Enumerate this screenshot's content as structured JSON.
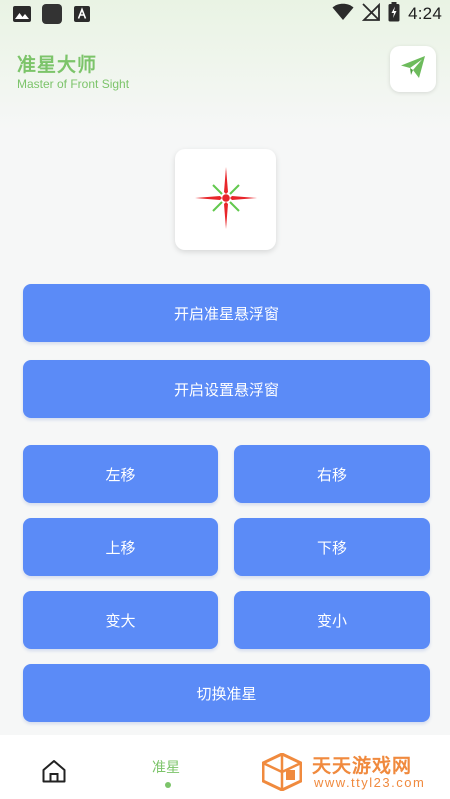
{
  "status_bar": {
    "time": "4:24",
    "left_icons": [
      "image-icon",
      "app-square-icon",
      "text-a-icon"
    ],
    "right_icons": [
      "wifi-icon",
      "signal-off-icon",
      "battery-charging-icon"
    ]
  },
  "header": {
    "title": "准星大师",
    "subtitle": "Master of Front Sight",
    "share_icon": "send-icon"
  },
  "preview": {
    "icon": "crosshair-icon"
  },
  "buttons": {
    "open_crosshair_window": "开启准星悬浮窗",
    "open_settings_window": "开启设置悬浮窗",
    "move_left": "左移",
    "move_right": "右移",
    "move_up": "上移",
    "move_down": "下移",
    "enlarge": "变大",
    "shrink": "变小",
    "switch_crosshair": "切换准星"
  },
  "bottom_nav": {
    "home_icon": "home-icon",
    "crosshair_label": "准星"
  },
  "watermark": {
    "title": "天天游戏网",
    "url": "www.ttyl23.com"
  },
  "colors": {
    "accent_green": "#7cc46a",
    "button_blue": "#5b8bf7",
    "watermark_orange": "#f08a3e",
    "crosshair_red": "#e8262b",
    "crosshair_green": "#62c94e"
  }
}
